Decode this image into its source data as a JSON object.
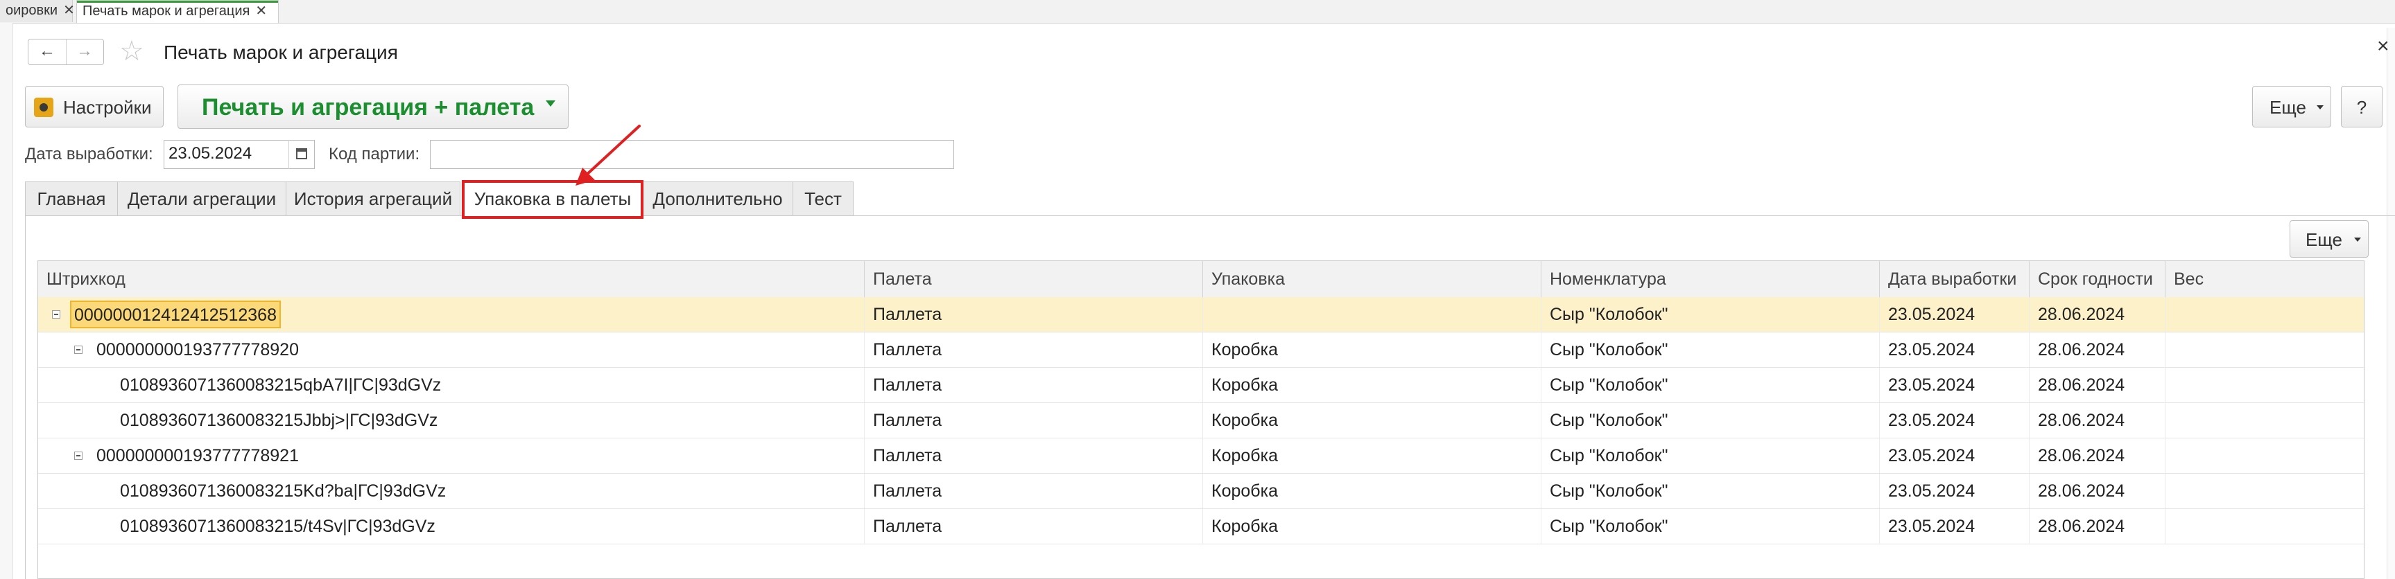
{
  "top_tabs": [
    {
      "label": "оировки",
      "close": "✕"
    },
    {
      "label": "Печать марок и агрегация",
      "close": "✕"
    }
  ],
  "nav": {
    "back": "←",
    "forward": "→"
  },
  "title": "Печать марок и агрегация",
  "window_close": "×",
  "toolbar": {
    "settings_label": "Настройки",
    "print_label": "Печать и агрегация + палета",
    "more_label": "Еще",
    "help_label": "?"
  },
  "fields": {
    "date_label": "Дата выработки:",
    "date_value": "23.05.2024",
    "party_label": "Код партии:",
    "party_value": ""
  },
  "form_tabs": [
    "Главная",
    "Детали агрегации",
    "История агрегаций",
    "Упаковка в палеты",
    "Дополнительно",
    "Тест"
  ],
  "selected_tab": "Упаковка в палеты",
  "table_more_label": "Еще",
  "table": {
    "columns": [
      "Штрихкод",
      "Палета",
      "Упаковка",
      "Номенклатура",
      "Дата выработки",
      "Срок годности",
      "Вес"
    ],
    "rows": [
      {
        "barcode": "000000012412412512368",
        "pallet": "Паллета",
        "pack": "",
        "item": "Сыр \"Колобок\"",
        "made": "23.05.2024",
        "expiry": "28.06.2024",
        "weight": ""
      },
      {
        "barcode": "000000000193777778920",
        "pallet": "Паллета",
        "pack": "Коробка",
        "item": "Сыр \"Колобок\"",
        "made": "23.05.2024",
        "expiry": "28.06.2024",
        "weight": ""
      },
      {
        "barcode": "0108936071360083215qbA7I|ГС|93dGVz",
        "pallet": "Паллета",
        "pack": "Коробка",
        "item": "Сыр \"Колобок\"",
        "made": "23.05.2024",
        "expiry": "28.06.2024",
        "weight": ""
      },
      {
        "barcode": "0108936071360083215Jbbj>|ГС|93dGVz",
        "pallet": "Паллета",
        "pack": "Коробка",
        "item": "Сыр \"Колобок\"",
        "made": "23.05.2024",
        "expiry": "28.06.2024",
        "weight": ""
      },
      {
        "barcode": "000000000193777778921",
        "pallet": "Паллета",
        "pack": "Коробка",
        "item": "Сыр \"Колобок\"",
        "made": "23.05.2024",
        "expiry": "28.06.2024",
        "weight": ""
      },
      {
        "barcode": "0108936071360083215Kd?ba|ГС|93dGVz",
        "pallet": "Паллета",
        "pack": "Коробка",
        "item": "Сыр \"Колобок\"",
        "made": "23.05.2024",
        "expiry": "28.06.2024",
        "weight": ""
      },
      {
        "barcode": "0108936071360083215/t4Sv|ГС|93dGVz",
        "pallet": "Паллета",
        "pack": "Коробка",
        "item": "Сыр \"Колобок\"",
        "made": "23.05.2024",
        "expiry": "28.06.2024",
        "weight": ""
      }
    ]
  },
  "colors": {
    "accent_green": "#1b8f2f",
    "highlight_red": "#e02020",
    "selected_row": "#fcf1c9"
  },
  "icons": [
    "gear-icon",
    "calendar-icon",
    "star-icon",
    "arrow-left-icon",
    "arrow-right-icon",
    "collapse-icon",
    "annotation-arrow-icon"
  ]
}
